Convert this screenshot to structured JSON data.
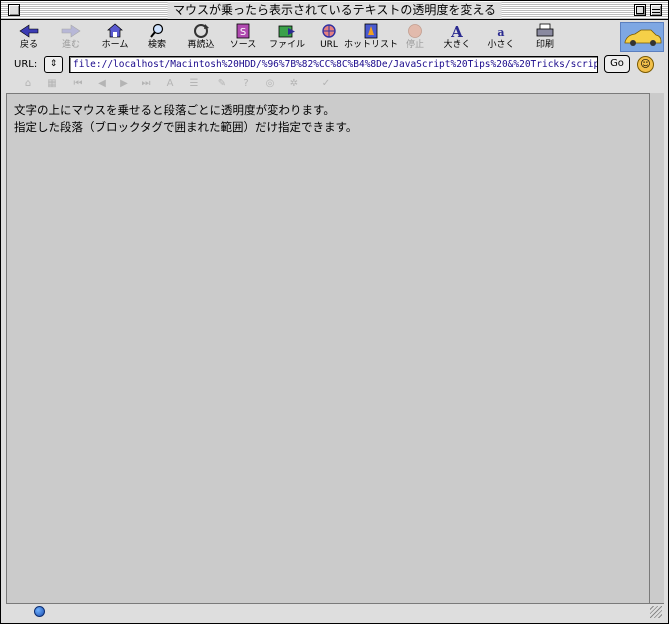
{
  "window": {
    "title": "マウスが乗ったら表示されているテキストの透明度を変える"
  },
  "toolbar": {
    "buttons": [
      {
        "label": "戻る",
        "icon": "back-arrow-icon",
        "enabled": true
      },
      {
        "label": "進む",
        "icon": "forward-arrow-icon",
        "enabled": false
      },
      {
        "label": "ホーム",
        "icon": "home-icon",
        "enabled": true
      },
      {
        "label": "検索",
        "icon": "search-icon",
        "enabled": true
      },
      {
        "label": "再読込",
        "icon": "reload-icon",
        "enabled": true
      },
      {
        "label": "ソース",
        "icon": "source-icon",
        "enabled": true
      },
      {
        "label": "ファイル",
        "icon": "file-icon",
        "enabled": true
      },
      {
        "label": "URL",
        "icon": "url-icon",
        "enabled": true
      },
      {
        "label": "ホットリスト",
        "icon": "hotlist-icon",
        "enabled": true
      },
      {
        "label": "停止",
        "icon": "stop-icon",
        "enabled": false
      },
      {
        "label": "大きく",
        "icon": "bigger-text-icon",
        "enabled": true
      },
      {
        "label": "小さく",
        "icon": "smaller-text-icon",
        "enabled": true
      },
      {
        "label": "印刷",
        "icon": "print-icon",
        "enabled": true
      }
    ]
  },
  "urlbar": {
    "label": "URL:",
    "value": "file://localhost/Macintosh%20HDD/%96%7B%82%CC%8C%B4%8De/JavaScript%20Tips%20&%20Tricks/scrip",
    "go_label": "Go"
  },
  "content": {
    "lines": [
      "文字の上にマウスを乗せると段落ごとに透明度が変わります。",
      "指定した段落（ブロックタグで囲まれた範囲）だけ指定できます。"
    ]
  }
}
